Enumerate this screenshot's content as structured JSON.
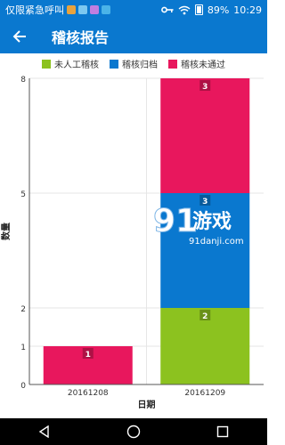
{
  "status_bar": {
    "carrier_text": "仅限紧急呼叫",
    "battery": "89%",
    "time": "10:29",
    "icons": [
      "app-notification-icon",
      "app-notification-icon",
      "app-notification-icon",
      "app-notification-icon",
      "key-icon",
      "wifi-icon",
      "battery-icon"
    ]
  },
  "app_bar": {
    "title": "稽核报告",
    "back_icon": "arrow-left-icon"
  },
  "colors": {
    "primary": "#0a78cf",
    "series_green": "#8cc21f",
    "series_blue": "#0a78cf",
    "series_pink": "#e8175d"
  },
  "chart_data": {
    "type": "bar",
    "stacked": true,
    "categories": [
      "20161208",
      "20161209"
    ],
    "series": [
      {
        "name": "未人工稽核",
        "values": [
          0,
          2
        ],
        "color": "#8cc21f"
      },
      {
        "name": "稽核归档",
        "values": [
          0,
          3
        ],
        "color": "#0a78cf"
      },
      {
        "name": "稽核未通过",
        "values": [
          1,
          3
        ],
        "color": "#e8175d"
      }
    ],
    "data_labels": [
      [
        "1"
      ],
      [
        "2",
        "3",
        "3"
      ]
    ],
    "xlabel": "日期",
    "ylabel": "数量",
    "y_ticks": [
      "0",
      "1",
      "2",
      "5",
      "8"
    ],
    "y_tick_values": [
      0,
      1,
      2,
      5,
      8
    ],
    "ylim": [
      0,
      8
    ],
    "legend_position": "top",
    "grid": true
  },
  "watermark": {
    "main_text": "91游戏",
    "url_text": "91danji.com"
  },
  "nav_bar": {
    "icons": [
      "back-triangle-icon",
      "home-circle-icon",
      "recents-square-icon"
    ]
  }
}
